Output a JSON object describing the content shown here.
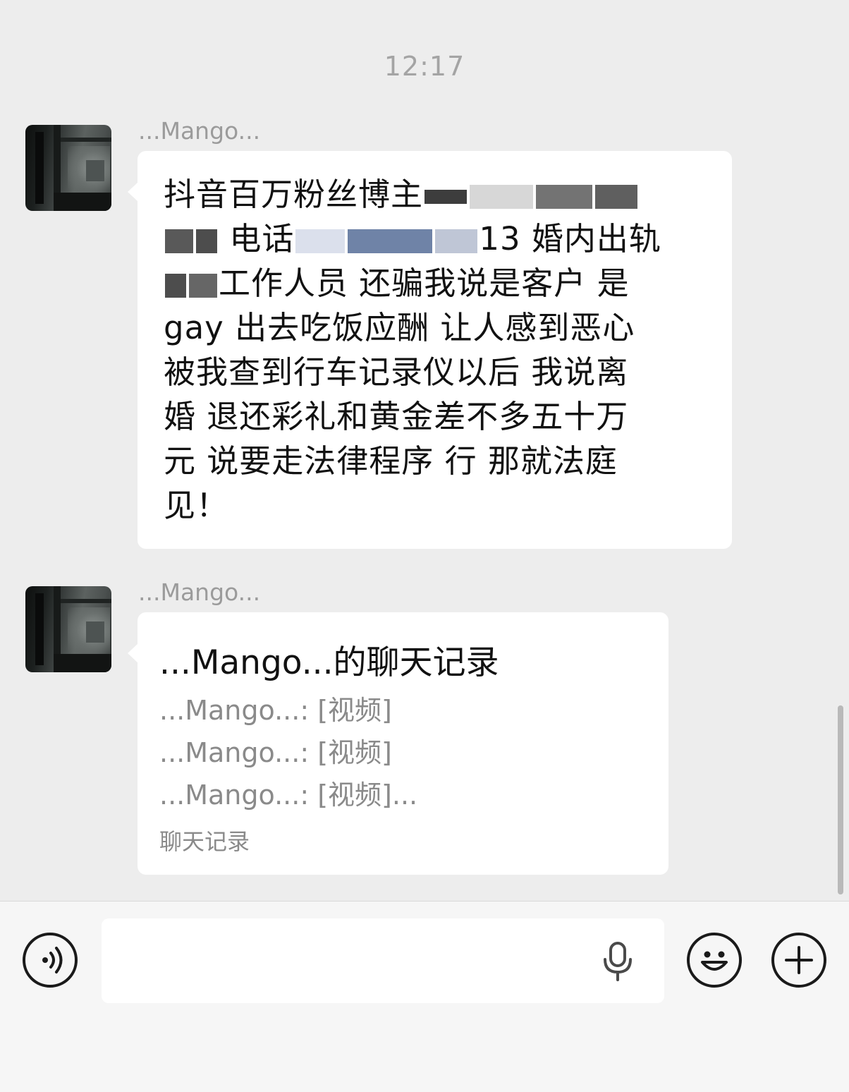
{
  "timestamp": "12:17",
  "messages": [
    {
      "sender": "...Mango...",
      "text_lines": [
        "抖音百万粉丝博主",
        "电话",
        "13 婚内出轨",
        "工作人员 还骗我说是客户 是",
        "gay 出去吃饭应酬 让人感到恶心",
        "被我查到行车记录仪以后 我说离",
        "婚 退还彩礼和黄金差不多五十万",
        "元 说要走法律程序 行 那就法庭",
        "见！"
      ]
    },
    {
      "sender": "...Mango...",
      "chat_record": {
        "title": "...Mango...的聊天记录",
        "entries": [
          "...Mango...: [视频]",
          "...Mango...: [视频]",
          "...Mango...: [视频]..."
        ],
        "footer": "聊天记录"
      }
    }
  ],
  "input_bar": {
    "voice_icon": "voice-mode-icon",
    "mic_icon": "microphone-icon",
    "emoji_icon": "emoji-icon",
    "plus_icon": "plus-icon",
    "message_value": ""
  }
}
